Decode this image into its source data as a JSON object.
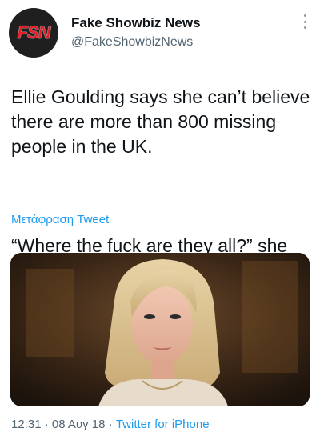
{
  "author": {
    "name": "Fake Showbiz News",
    "handle": "@FakeShowbizNews",
    "avatar_text": "FSN"
  },
  "tweet": {
    "line1": "Ellie Goulding says she can’t believe there are more than 800 missing people in the UK.",
    "line2": "“Where the fuck are they all?” she said"
  },
  "translate_label": "Μετάφραση Tweet",
  "meta": {
    "time": "12:31",
    "separator": "·",
    "date": "08 Αυγ 18",
    "source": "Twitter for iPhone"
  },
  "icons": {
    "more": "more-vertical-icon"
  },
  "colors": {
    "link": "#1d9bf0",
    "secondary": "#536471",
    "logo_red": "#e3202a"
  }
}
